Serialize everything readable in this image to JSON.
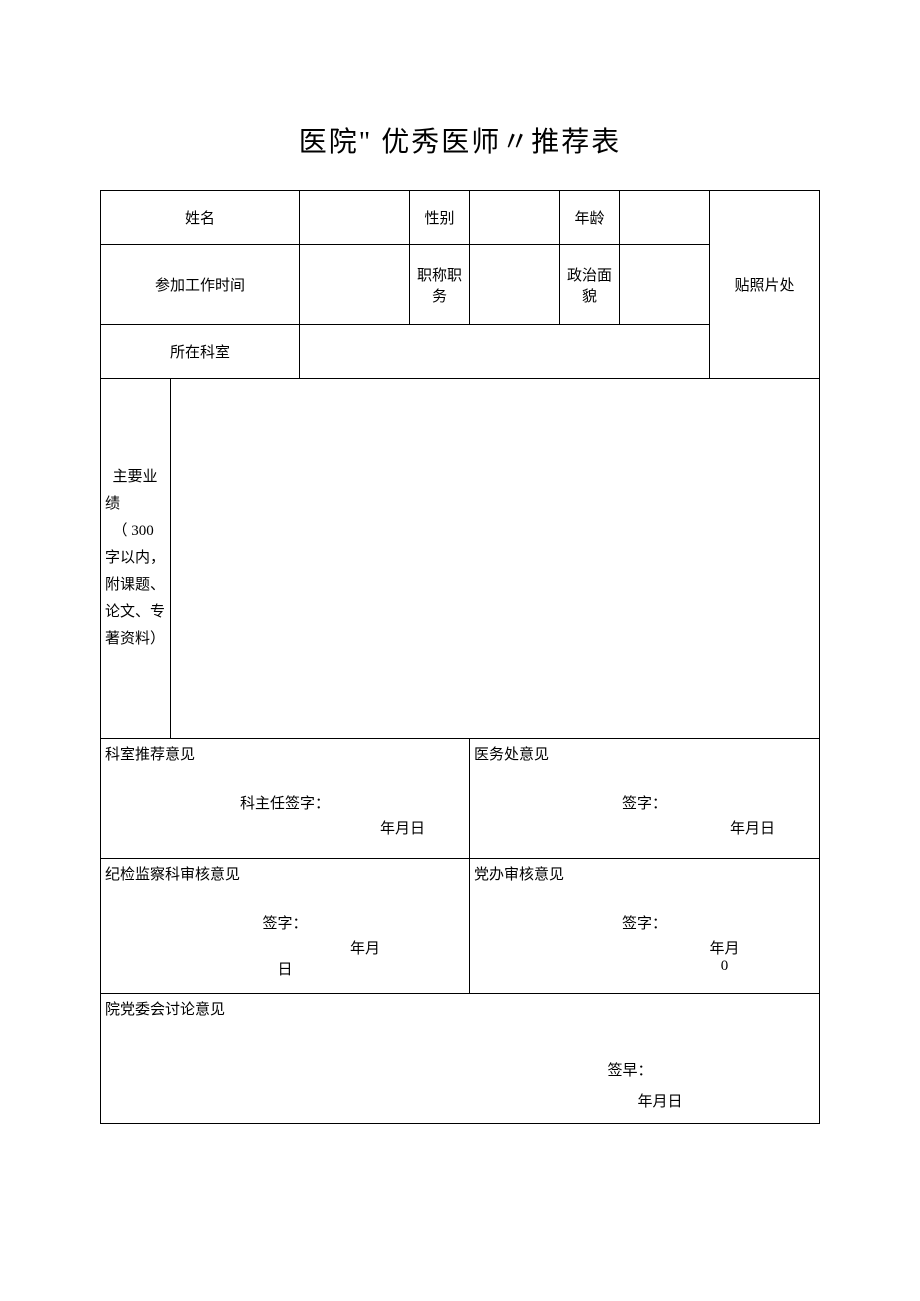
{
  "title": "医院\" 优秀医师〃推荐表",
  "fields": {
    "name_label": "姓名",
    "gender_label": "性别",
    "age_label": "年龄",
    "work_start_label": "参加工作时间",
    "title_position_label": "职称职务",
    "political_label": "政治面貌",
    "photo_label": "贴照片处",
    "dept_label": "所在科室",
    "achievement_label": "主要业绩\n（ 300字以内，附课题、论文、专著资料）"
  },
  "opinions": {
    "dept_rec_title": "科室推荐意见",
    "dept_rec_sign": "科主任签字：",
    "med_office_title": "医务处意见",
    "med_office_sign": "签字：",
    "discipline_title": "纪检监察科审核意见",
    "discipline_sign": "签字：",
    "discipline_extra": "日",
    "party_office_title": "党办审核意见",
    "party_office_sign": "签字：",
    "party_office_extra": "0",
    "committee_title": "院党委会讨论意见",
    "committee_sign": "签早：",
    "date_full": "年月日",
    "date_ym": "年月"
  }
}
